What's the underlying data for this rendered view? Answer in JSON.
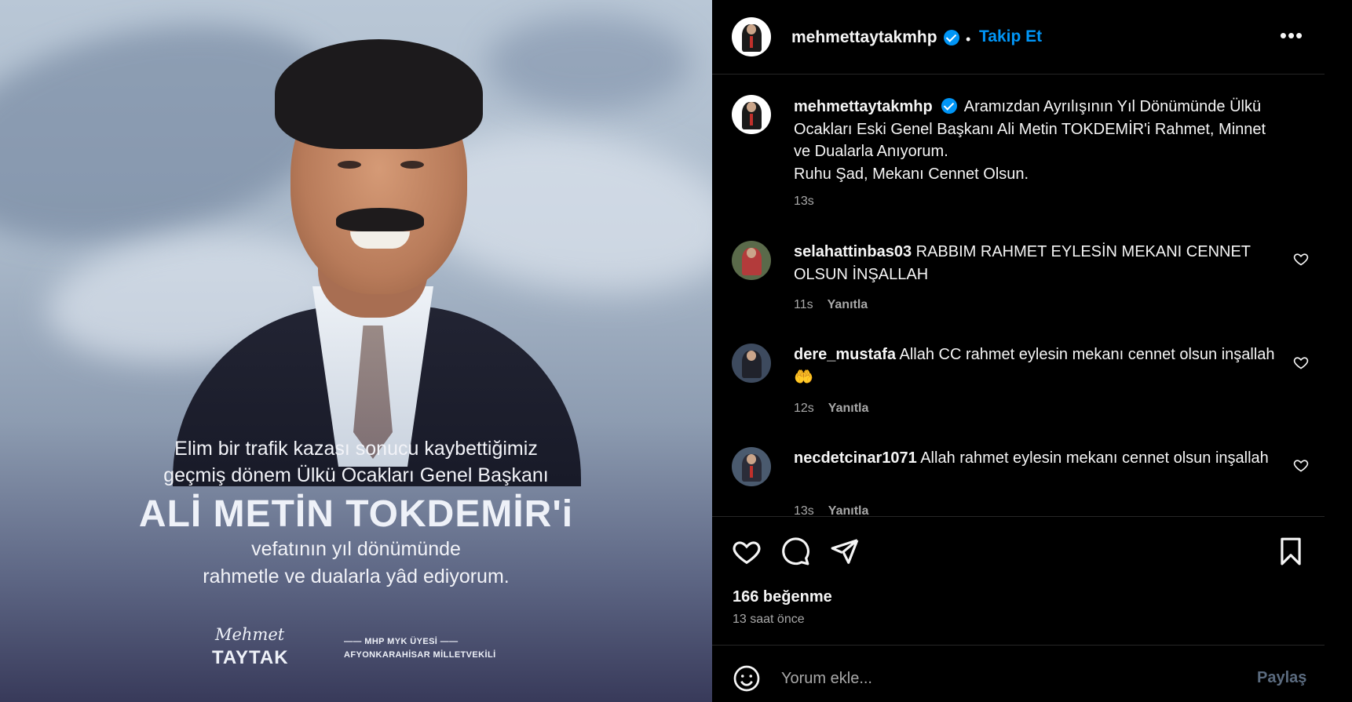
{
  "post_image": {
    "caption_line1": "Elim bir trafik kazası sonucu kaybettiğimiz",
    "caption_line2": "geçmiş dönem Ülkü Ocakları Genel Başkanı",
    "name": "ALİ METİN TOKDEMİR'i",
    "caption_line3": "vefatının yıl dönümünde",
    "caption_line4": "rahmetle ve dualarla yâd ediyorum.",
    "logo_script": "Mehmet",
    "logo_name": "TAYTAK",
    "logo_line1": "—— MHP MYK ÜYESİ ——",
    "logo_line2": "AFYONKARAHİSAR MİLLETVEKİLİ"
  },
  "header": {
    "username": "mehmettaytakmhp",
    "separator": "•",
    "follow_label": "Takip Et",
    "more_label": "•••"
  },
  "caption": {
    "username": "mehmettaytakmhp",
    "text": "Aramızdan Ayrılışının Yıl Dönümünde Ülkü Ocakları Eski Genel Başkanı Ali Metin TOKDEMİR'i Rahmet, Minnet ve Dualarla Anıyorum.",
    "text2": "Ruhu Şad, Mekanı Cennet Olsun.",
    "time": "13s"
  },
  "comments": [
    {
      "username": "selahattinbas03",
      "text": "RABBIM RAHMET EYLESİN MEKANI CENNET OLSUN İNŞALLAH",
      "time": "11s",
      "reply": "Yanıtla"
    },
    {
      "username": "dere_mustafa",
      "text": "Allah CC rahmet eylesin mekanı cennet olsun inşallah 🤲",
      "time": "12s",
      "reply": "Yanıtla"
    },
    {
      "username": "necdetcinar1071",
      "text": "Allah rahmet eylesin mekanı cennet olsun inşallah",
      "time": "13s",
      "reply": "Yanıtla"
    }
  ],
  "likes": "166 beğenme",
  "posted_ago": "13 saat önce",
  "comment_box": {
    "placeholder": "Yorum ekle...",
    "share_label": "Paylaş"
  },
  "colors": {
    "accent": "#0095f6",
    "muted": "#a8a8a8",
    "background": "#000000"
  }
}
